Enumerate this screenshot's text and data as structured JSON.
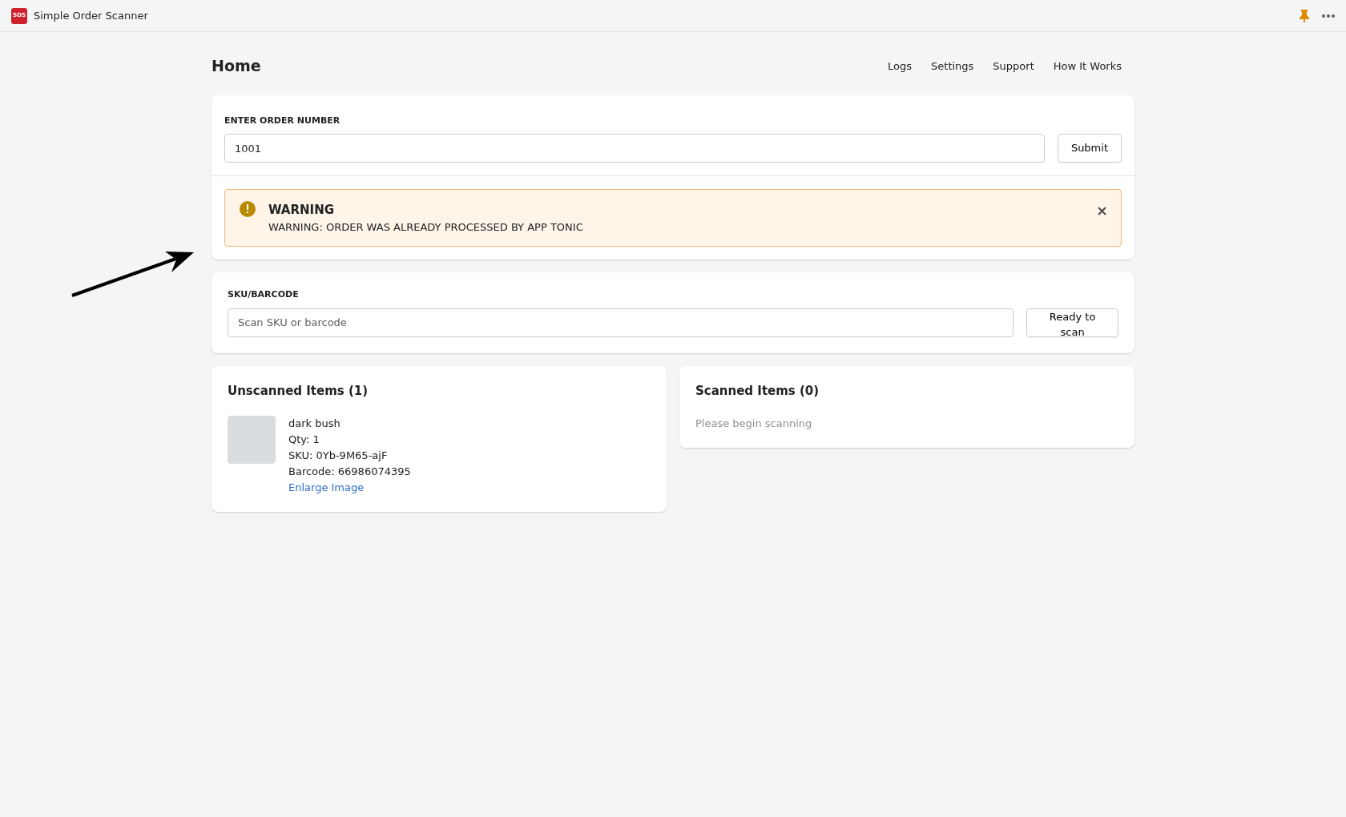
{
  "app_bar": {
    "logo_text": "SOS",
    "title": "Simple Order Scanner"
  },
  "page": {
    "title": "Home",
    "nav_links": [
      "Logs",
      "Settings",
      "Support",
      "How It Works"
    ]
  },
  "order_form": {
    "label": "ENTER ORDER NUMBER",
    "value": "1001",
    "button": "Submit"
  },
  "banner": {
    "kind": "warning",
    "title": "WARNING",
    "message": "WARNING: ORDER WAS ALREADY PROCESSED BY APP TONIC"
  },
  "scan_form": {
    "label": "SKU/BARCODE",
    "placeholder": "Scan SKU or barcode",
    "button": "Ready to scan"
  },
  "unscanned": {
    "title": "Unscanned Items (1)",
    "items": [
      {
        "name": "dark bush",
        "qty": "Qty: 1",
        "sku": "SKU: 0Yb-9M65-ajF",
        "barcode": "Barcode: 66986074395",
        "link": "Enlarge Image"
      }
    ]
  },
  "scanned": {
    "title": "Scanned Items (0)",
    "empty_text": "Please begin scanning"
  }
}
